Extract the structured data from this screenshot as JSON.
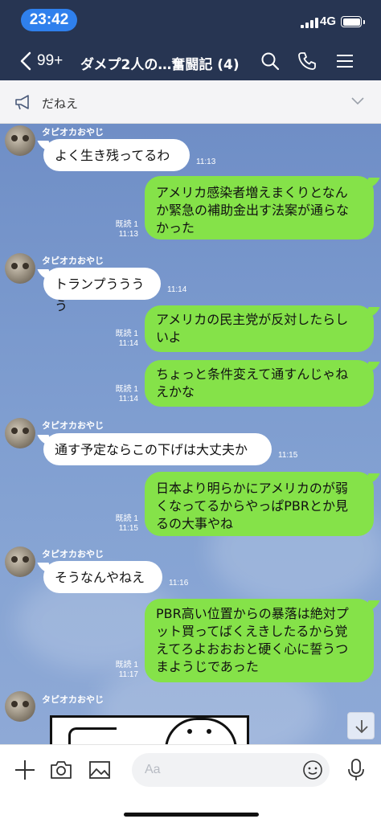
{
  "status_bar": {
    "time": "23:42",
    "network": "4G"
  },
  "nav": {
    "back_count": "99+",
    "title": "ダメプ2人の…奮闘記 (4)"
  },
  "announcement": {
    "text": "だねえ"
  },
  "messages": [
    {
      "sender": "タピオカおやじ",
      "text_lines": [
        "よく生き残ってるわ"
      ],
      "time": "11:13"
    },
    {
      "text_lines": [
        "アメリカ感染者増えまくりとなん",
        "か緊急の補助金出す法案が通らな",
        "かった"
      ],
      "read": "既読 1",
      "time": "11:13"
    },
    {
      "sender": "タピオカおやじ",
      "text_lines": [
        "トランプうううう"
      ],
      "time": "11:14"
    },
    {
      "text_lines": [
        "アメリカの民主党が反対したらし",
        "いよ"
      ],
      "read": "既読 1",
      "time": "11:14"
    },
    {
      "text_lines": [
        "ちょっと条件変えて通すんじゃね",
        "えかな"
      ],
      "read": "既読 1",
      "time": "11:14"
    },
    {
      "sender": "タピオカおやじ",
      "text_lines": [
        "通す予定ならこの下げは大丈夫か"
      ],
      "time": "11:15"
    },
    {
      "text_lines": [
        "日本より明らかにアメリカのが弱",
        "くなってるからやっぱPBRとか見",
        "るの大事やね"
      ],
      "read": "既読 1",
      "time": "11:15"
    },
    {
      "sender": "タピオカおやじ",
      "text_lines": [
        "そうなんやねえ"
      ],
      "time": "11:16"
    },
    {
      "text_lines": [
        "PBR高い位置からの暴落は絶対プ",
        "ット買ってばくえきしたるから覚",
        "えてろよおおおと硬く心に誓うつ",
        "まようじであった"
      ],
      "read": "既読 1",
      "time": "11:17"
    },
    {
      "sender": "タピオカおやじ"
    }
  ],
  "input": {
    "placeholder": "Aa"
  },
  "colors": {
    "header_bg": "#273552",
    "time_pill": "#2f80ed",
    "bubble_out": "#85e249",
    "bubble_in": "#ffffff",
    "chat_bg": "#7b9ace"
  },
  "icons": [
    "search-icon",
    "phone-icon",
    "menu-icon",
    "megaphone-icon",
    "chevron-down-icon",
    "plus-icon",
    "camera-icon",
    "image-icon",
    "emoji-icon",
    "microphone-icon",
    "arrow-down-icon"
  ]
}
